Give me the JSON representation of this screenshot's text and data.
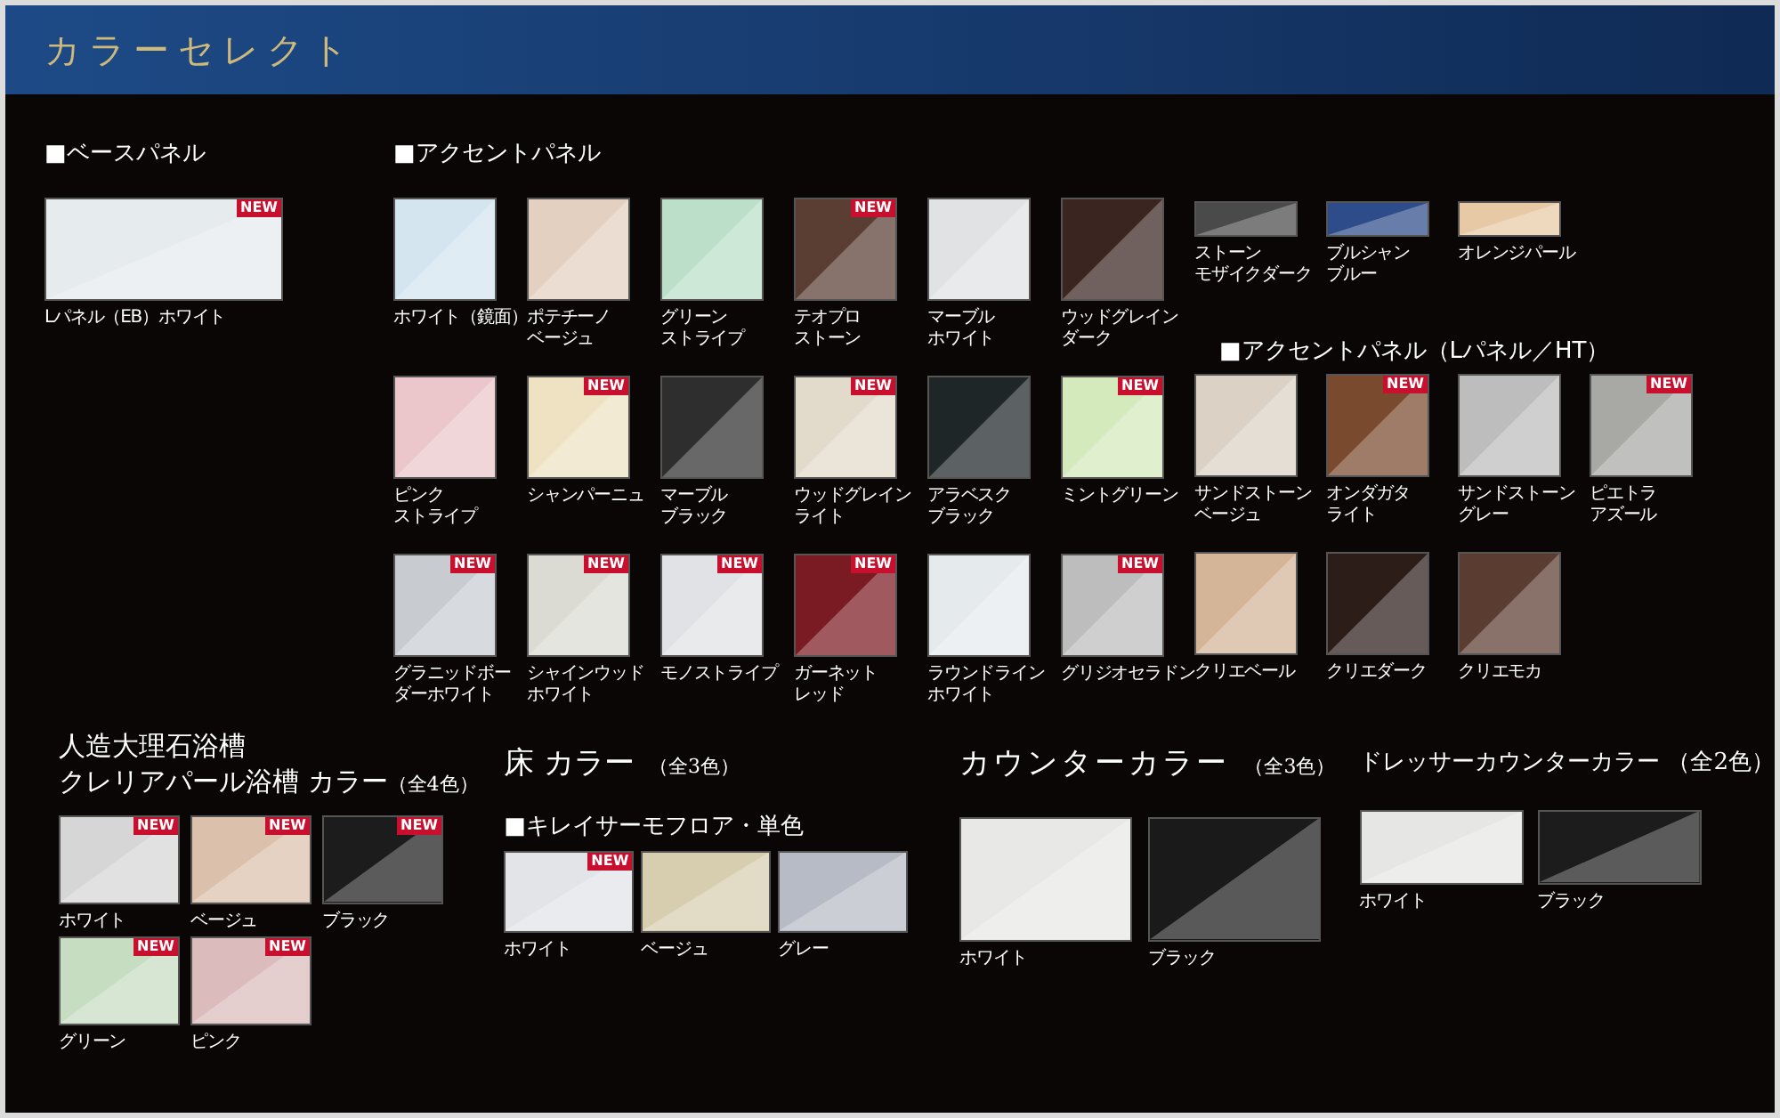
{
  "header": {
    "title": "カラーセレクト"
  },
  "base_panel": {
    "heading": "■ベースパネル",
    "swatches": [
      {
        "lines": [
          "Lパネル（EB）ホワイト"
        ],
        "color": "#e6ebee",
        "badge": "NEW"
      }
    ]
  },
  "accent_panel": {
    "heading": "■アクセントパネル",
    "swatches": [
      {
        "lines": [
          "ホワイト（鏡面）"
        ],
        "color": "#d5e5f0"
      },
      {
        "lines": [
          "ポテチーノ",
          "ベージュ"
        ],
        "color": "#e4d0c0"
      },
      {
        "lines": [
          "グリーン",
          "ストライプ"
        ],
        "color": "#bcdfca"
      },
      {
        "lines": [
          "テオプロ",
          "ストーン"
        ],
        "color": "#5a3e34",
        "badge": "NEW"
      },
      {
        "lines": [
          "マーブル",
          "ホワイト"
        ],
        "color": "#e0e2e4"
      },
      {
        "lines": [
          "ウッドグレイン",
          "ダーク"
        ],
        "color": "#3a2520"
      },
      {
        "lines": [
          "ピンク",
          "ストライプ"
        ],
        "color": "#ebc6ca"
      },
      {
        "lines": [
          "シャンパーニュ"
        ],
        "color": "#eee2c2",
        "badge": "NEW"
      },
      {
        "lines": [
          "マーブル",
          "ブラック"
        ],
        "color": "#2e2e2e"
      },
      {
        "lines": [
          "ウッドグレイン",
          "ライト"
        ],
        "color": "#e2dacb",
        "badge": "NEW"
      },
      {
        "lines": [
          "アラベスク",
          "ブラック"
        ],
        "color": "#1e2628"
      },
      {
        "lines": [
          "ミントグリーン"
        ],
        "color": "#d4eabd",
        "badge": "NEW"
      },
      {
        "lines": [
          "グラニッドボー",
          "ダーホワイト"
        ],
        "color": "#c8ccd1",
        "badge": "NEW"
      },
      {
        "lines": [
          "シャインウッド",
          "ホワイト"
        ],
        "color": "#dbdbd3",
        "badge": "NEW"
      },
      {
        "lines": [
          "モノストライプ"
        ],
        "color": "#e0e2e5",
        "badge": "NEW"
      },
      {
        "lines": [
          "ガーネット",
          "レッド"
        ],
        "color": "#7a1a22",
        "badge": "NEW"
      },
      {
        "lines": [
          "ラウンドライン",
          "ホワイト"
        ],
        "color": "#e5ebed"
      },
      {
        "lines": [
          "グリジオセラドン"
        ],
        "color": "#bdbdbd",
        "badge": "NEW"
      }
    ],
    "wide_swatches": [
      {
        "lines": [
          "ストーン",
          "モザイクダーク"
        ],
        "color": "#4a4a4a"
      },
      {
        "lines": [
          "ブルシャン",
          "ブルー"
        ],
        "color": "#2f4c8a"
      },
      {
        "lines": [
          "オレンジパール"
        ],
        "color": "#e8c9a6"
      }
    ]
  },
  "accent_panel_ht": {
    "heading": "■アクセントパネル（Lパネル／HT）",
    "swatches": [
      {
        "lines": [
          "サンドストーン",
          "ベージュ"
        ],
        "color": "#dbd1c5"
      },
      {
        "lines": [
          "オンダガタ",
          "ライト"
        ],
        "color": "#7a4a2e",
        "badge": "NEW"
      },
      {
        "lines": [
          "サンドストーン",
          "グレー"
        ],
        "color": "#bdbdbd"
      },
      {
        "lines": [
          "ピエトラ",
          "アズール"
        ],
        "color": "#a8a8a5",
        "badge": "NEW"
      },
      {
        "lines": [
          "クリエベール"
        ],
        "color": "#d5b597"
      },
      {
        "lines": [
          "クリエダーク"
        ],
        "color": "#2c1d18"
      },
      {
        "lines": [
          "クリエモカ"
        ],
        "color": "#5a3c30"
      }
    ]
  },
  "bathtub": {
    "title": "人造大理石浴槽",
    "subtitle": "クレリアパール浴槽 カラー",
    "count": "（全4色）",
    "swatches": [
      {
        "lines": [
          "ホワイト"
        ],
        "color": "#d6d6d6",
        "badge": "NEW"
      },
      {
        "lines": [
          "ベージュ"
        ],
        "color": "#dbc1ac",
        "badge": "NEW"
      },
      {
        "lines": [
          "ブラック"
        ],
        "color": "#1c1c1c",
        "badge": "NEW"
      },
      {
        "lines": [
          "グリーン"
        ],
        "color": "#c6ddc2",
        "badge": "NEW"
      },
      {
        "lines": [
          "ピンク"
        ],
        "color": "#dbbbbb",
        "badge": "NEW"
      }
    ]
  },
  "floor": {
    "title": "床 カラー",
    "count": "（全3色）",
    "subheading": "■キレイサーモフロア・単色",
    "swatches": [
      {
        "lines": [
          "ホワイト"
        ],
        "color": "#e2e4e8",
        "badge": "NEW"
      },
      {
        "lines": [
          "ベージュ"
        ],
        "color": "#d7cdaf"
      },
      {
        "lines": [
          "グレー"
        ],
        "color": "#b7bbc5"
      }
    ]
  },
  "counter": {
    "title": "カウンターカラー",
    "count": "（全3色）",
    "swatches": [
      {
        "lines": [
          "ホワイト"
        ],
        "color": "#e8e8e6"
      },
      {
        "lines": [
          "ブラック"
        ],
        "color": "#1a1a1a"
      }
    ]
  },
  "dresser_counter": {
    "title": "ドレッサーカウンターカラー",
    "count": "（全2色）",
    "swatches": [
      {
        "lines": [
          "ホワイト"
        ],
        "color": "#e6e6e4"
      },
      {
        "lines": [
          "ブラック"
        ],
        "color": "#1c1c1c"
      }
    ]
  }
}
